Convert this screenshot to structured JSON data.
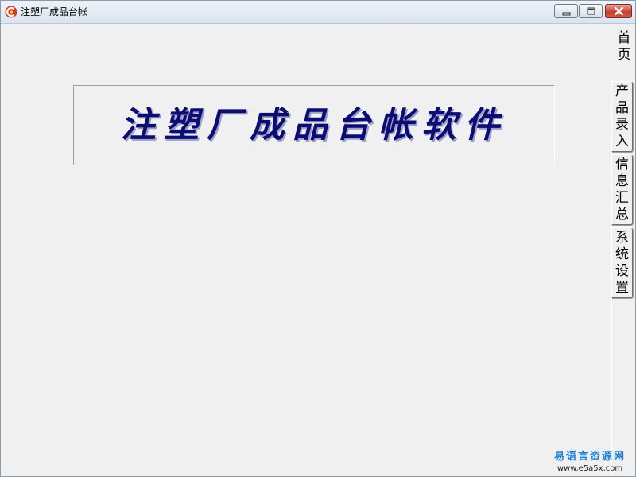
{
  "window": {
    "title": "注塑厂成品台帐",
    "icon": "app-logo-icon"
  },
  "controls": {
    "minimize_icon": "minimize-icon",
    "maximize_icon": "maximize-icon",
    "close_icon": "close-icon",
    "close_color": "#c7402f"
  },
  "banner": {
    "title": "注塑厂成品台帐软件",
    "title_color": "#0c0c72"
  },
  "tabs": [
    {
      "label": "首页",
      "selected": true
    },
    {
      "label": "产品录入",
      "selected": false
    },
    {
      "label": "信息汇总",
      "selected": false
    },
    {
      "label": "系统设置",
      "selected": false
    }
  ],
  "watermark": {
    "title": "易语言资源网",
    "url": "www.e5a5x.com",
    "color": "#1a7fd6"
  }
}
